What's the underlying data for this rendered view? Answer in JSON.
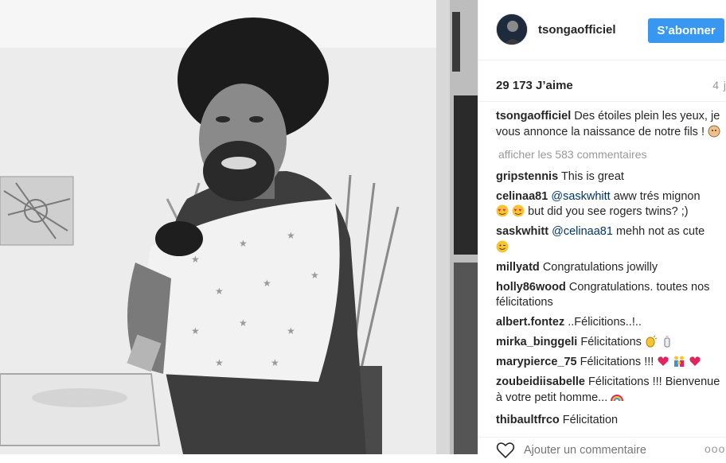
{
  "header": {
    "username": "tsongaofficiel",
    "follow_label": "S’abonner"
  },
  "post": {
    "likes": "29 173 J’aime",
    "time_ago": "4 j",
    "caption_user": "tsongaofficiel",
    "caption_text": "Des étoiles plein les yeux, je vous annonce la naissance de notre fils !",
    "load_more": "afficher les 583 commentaires"
  },
  "comments": [
    {
      "user": "gripstennis",
      "text": "This is great"
    },
    {
      "user": "celinaa81",
      "mention": "@saskwhitt",
      "text": "aww trés mignon",
      "text2": "but did you see rogers twins? ;)"
    },
    {
      "user": "saskwhitt",
      "mention": "@celinaa81",
      "text": "mehh not as cute"
    },
    {
      "user": "millyatd",
      "text": "Congratulations jowilly"
    },
    {
      "user": "holly86wood",
      "text": "Congratulations. toutes nos félicitations"
    },
    {
      "user": "albert.fontez",
      "text": "..Félicitions..!.."
    },
    {
      "user": "mirka_binggeli",
      "text": "Félicitations"
    },
    {
      "user": "marypierce_75",
      "text": "Félicitations !!!"
    },
    {
      "user": "zoubeidiisabelle",
      "text": "Félicitations !!! Bienvenue à votre petit homme..."
    },
    {
      "user": "thibaultfrco",
      "text": "Félicitation"
    }
  ],
  "footer": {
    "comment_placeholder": "Ajouter un commentaire",
    "more_label": "ooo"
  },
  "icons": {
    "heart": "heart-outline-icon",
    "more": "more-options-icon"
  },
  "colors": {
    "accent": "#3897f0",
    "mention": "#003569",
    "muted": "#999999"
  }
}
